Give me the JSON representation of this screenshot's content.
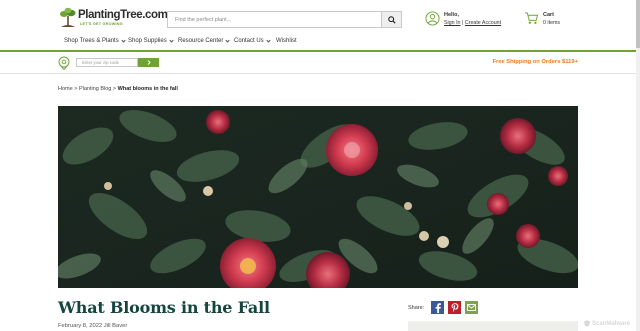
{
  "header": {
    "logo_text": "PlantingTree.com",
    "logo_tagline": "LET'S GET GROWING",
    "search": {
      "placeholder": "Find the perfect plant..."
    },
    "account": {
      "greeting": "Hello,",
      "sign_in": "Sign In",
      "separator": "|",
      "create_account": "Create Account"
    },
    "cart": {
      "label": "Cart",
      "items": "0 items"
    }
  },
  "nav": {
    "items": [
      {
        "label": "Shop Trees & Plants",
        "dropdown": true
      },
      {
        "label": "Shop Supplies",
        "dropdown": true
      },
      {
        "label": "Resource Center",
        "dropdown": true
      },
      {
        "label": "Contact Us",
        "dropdown": true
      },
      {
        "label": "Wishlist",
        "dropdown": false
      }
    ]
  },
  "zipbar": {
    "zip_placeholder": "Enter your zip code",
    "shipping_text": "Free Shipping on Orders $119+"
  },
  "breadcrumb": {
    "items": [
      "Home",
      "Planting Blog",
      "What blooms in the fall"
    ],
    "separator": ">"
  },
  "article": {
    "title": "What Blooms in the Fall",
    "meta": "February 8, 2022 Jill Baver"
  },
  "share": {
    "label": "Share:",
    "icons": [
      "facebook-icon",
      "pinterest-icon",
      "email-icon"
    ]
  },
  "watermark": "ScanMalware",
  "colors": {
    "brand_green": "#6fa338",
    "title_teal": "#14463e",
    "shipping_orange": "#f07a22",
    "facebook": "#3b5998",
    "pinterest": "#bd1f2d",
    "email": "#7fa24d"
  }
}
